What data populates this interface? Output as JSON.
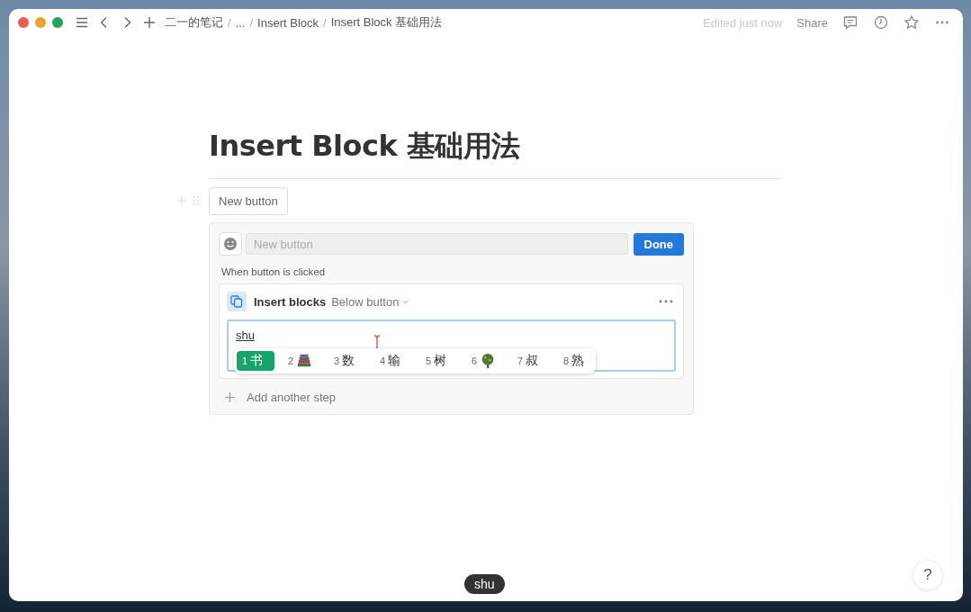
{
  "breadcrumbs": [
    {
      "label": "二一的笔记",
      "separator": "/"
    },
    {
      "label": "...",
      "separator": "/"
    },
    {
      "label": "Insert Block",
      "separator": "/"
    },
    {
      "label": "Insert Block 基础用法"
    }
  ],
  "topbar": {
    "status": "Edited just now",
    "share": "Share"
  },
  "page": {
    "title": "Insert Block 基础用法",
    "button_label": "New button"
  },
  "editor": {
    "name_placeholder": "New button",
    "done": "Done",
    "trigger": "When button is clicked",
    "step": {
      "action": "Insert blocks",
      "position": "Below button",
      "input_value": "shu"
    },
    "add_step": "Add another step"
  },
  "ime": {
    "candidates": [
      {
        "number": "1",
        "text": "书",
        "kind": "char",
        "selected": true
      },
      {
        "number": "2",
        "kind": "books",
        "selected": false
      },
      {
        "number": "3",
        "text": "数",
        "kind": "char",
        "selected": false
      },
      {
        "number": "4",
        "text": "输",
        "kind": "char",
        "selected": false
      },
      {
        "number": "5",
        "text": "树",
        "kind": "char",
        "selected": false
      },
      {
        "number": "6",
        "kind": "tree",
        "selected": false
      },
      {
        "number": "7",
        "text": "叔",
        "kind": "char",
        "selected": false
      },
      {
        "number": "8",
        "text": "熟",
        "kind": "char",
        "selected": false
      }
    ]
  },
  "keystroke_badge": "shu",
  "help": "?"
}
